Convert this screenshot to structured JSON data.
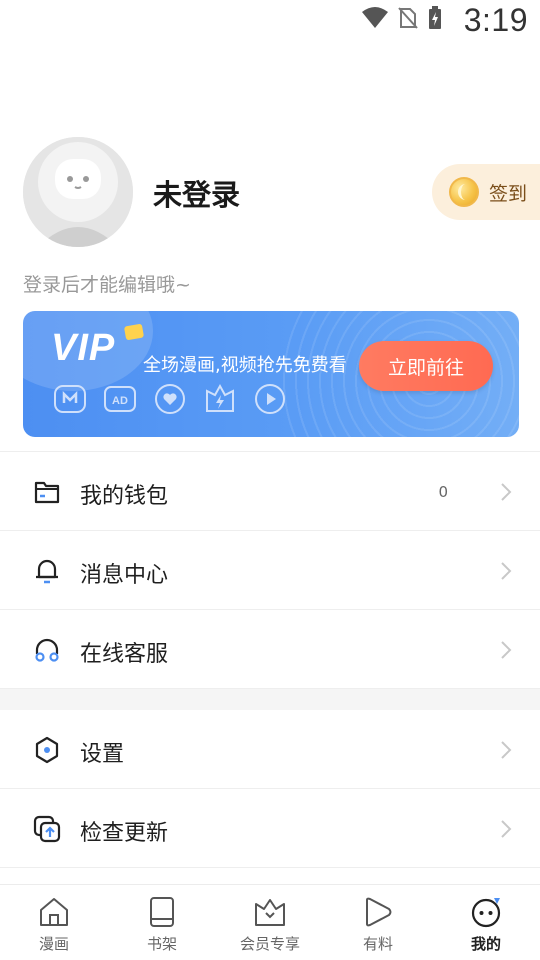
{
  "status_bar": {
    "time": "3:19"
  },
  "profile": {
    "username": "未登录",
    "subtitle": "登录后才能编辑哦~",
    "checkin_label": "签到"
  },
  "vip": {
    "logo": "VIP",
    "promo_text": "全场漫画,视频抢先免费看",
    "button_label": "立即前往",
    "perk_icons": [
      "mask-icon",
      "ad-free-icon",
      "heart-icon",
      "lightning-icon",
      "play-icon"
    ]
  },
  "menu": {
    "group1": [
      {
        "label": "我的钱包",
        "value": "0",
        "icon": "wallet-icon"
      },
      {
        "label": "消息中心",
        "value": "",
        "icon": "bell-icon"
      },
      {
        "label": "在线客服",
        "value": "",
        "icon": "headphones-icon"
      }
    ],
    "group2": [
      {
        "label": "设置",
        "value": "",
        "icon": "settings-icon"
      },
      {
        "label": "检查更新",
        "value": "",
        "icon": "update-icon"
      }
    ]
  },
  "bottom_nav": [
    {
      "label": "漫画",
      "icon": "home-icon",
      "active": false
    },
    {
      "label": "书架",
      "icon": "book-icon",
      "active": false
    },
    {
      "label": "会员专享",
      "icon": "crown-icon",
      "active": false
    },
    {
      "label": "有料",
      "icon": "play-icon",
      "active": false
    },
    {
      "label": "我的",
      "icon": "profile-face-icon",
      "active": true
    }
  ],
  "colors": {
    "accent_blue": "#4d8ff2",
    "vip_button": "#ff6a52",
    "checkin_bg": "#fcefdc"
  }
}
